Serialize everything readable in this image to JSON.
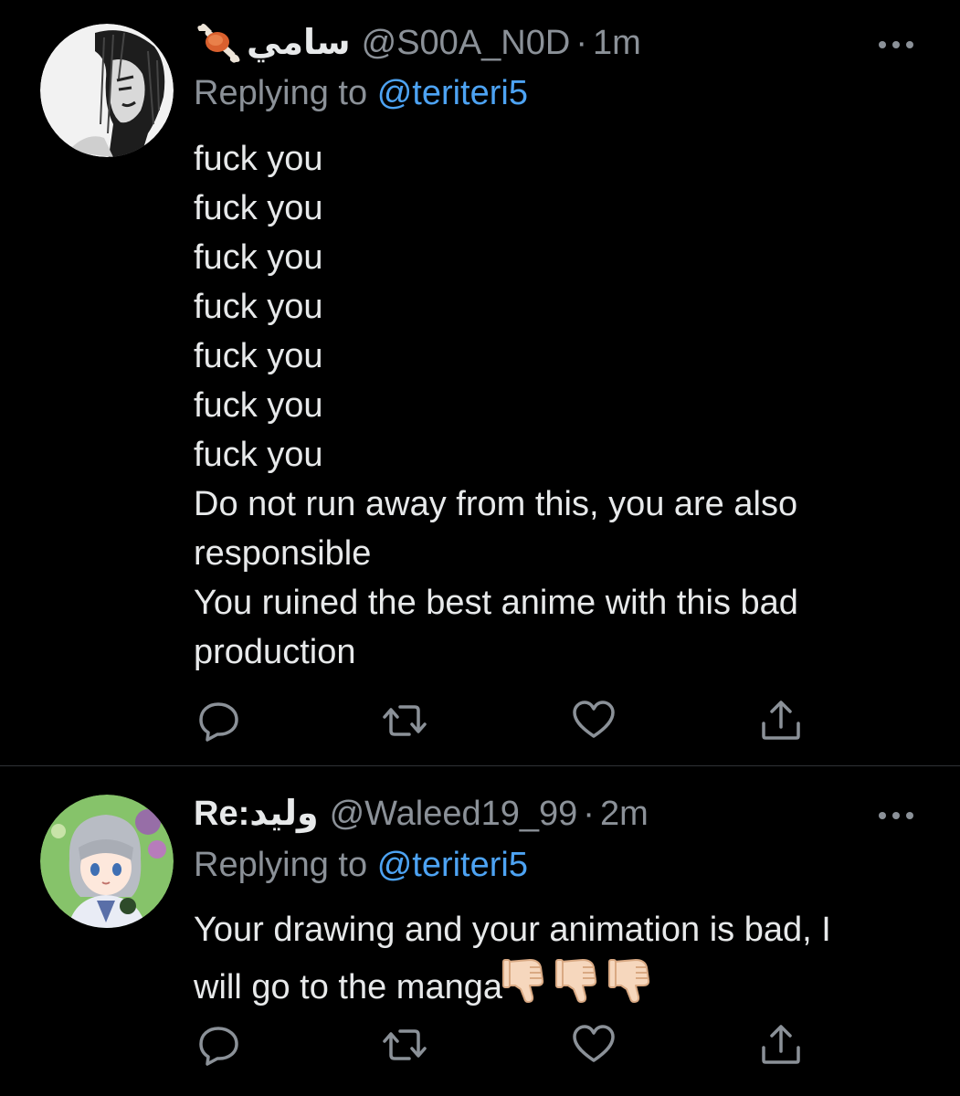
{
  "tweets": [
    {
      "display_name": "سامي",
      "handle": "@S00A_N0D",
      "separator": "·",
      "time": "1m",
      "reply_prefix": "Replying to",
      "reply_to": "@teriteri5",
      "body_lines": [
        "fuck you",
        "fuck you",
        "fuck you",
        "fuck you",
        "fuck you",
        "fuck you",
        "fuck you",
        "Do not run away from this, you are also",
        "responsible",
        "You ruined the best anime with this bad",
        "production"
      ]
    },
    {
      "display_name": "Re:وليد",
      "handle": "@Waleed19_99",
      "separator": "·",
      "time": "2m",
      "reply_prefix": "Replying to",
      "reply_to": "@teriteri5",
      "body_lines": [
        "Your drawing and your animation is bad, I",
        "will go to the manga"
      ]
    }
  ],
  "icons": {
    "badge": "meat-on-bone-icon",
    "more": "more-horizontal-icon",
    "reply": "reply-icon",
    "retweet": "retweet-icon",
    "like": "heart-icon",
    "share": "share-icon",
    "thumbs": "thumbs-down-icon"
  },
  "colors": {
    "background": "#000000",
    "text": "#e7e9ea",
    "muted": "#8b9198",
    "link": "#4da3f3",
    "divider": "#2f3336"
  }
}
